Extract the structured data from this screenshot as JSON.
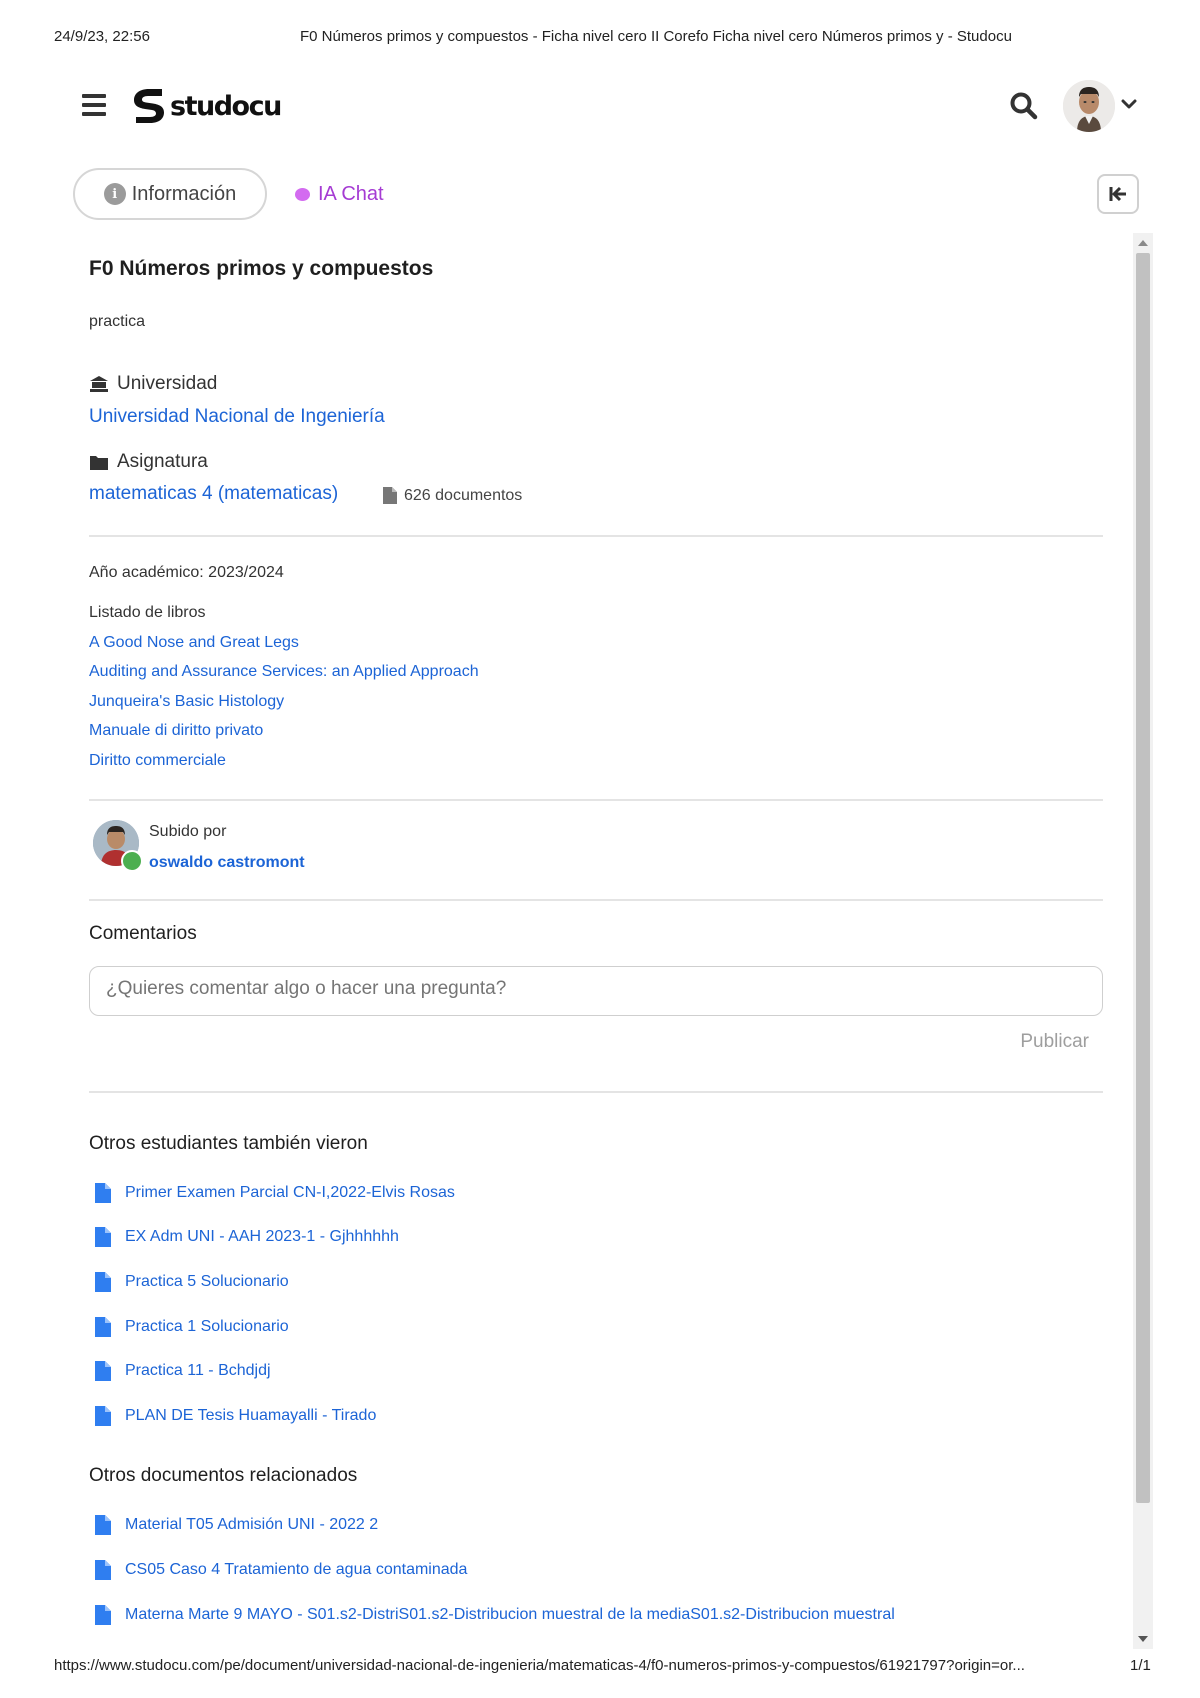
{
  "print_header": {
    "date": "24/9/23, 22:56",
    "title": "F0 Números primos y compuestos - Ficha nivel cero II Corefo Ficha nivel cero Números primos y - Studocu"
  },
  "print_footer": {
    "url": "https://www.studocu.com/pe/document/universidad-nacional-de-ingenieria/matematicas-4/f0-numeros-primos-y-compuestos/61921797?origin=or...",
    "page": "1/1"
  },
  "header": {
    "logo_text": "studocu"
  },
  "tabs": {
    "info_label": "Información",
    "chat_label": "IA Chat"
  },
  "document": {
    "title": "F0 Números primos y compuestos",
    "description": "practica",
    "university_label": "Universidad",
    "university_name": "Universidad Nacional de Ingeniería",
    "subject_label": "Asignatura",
    "subject_name": "matematicas 4 (matematicas)",
    "documents_count": "626 documentos",
    "academic_year": "Año académico: 2023/2024",
    "books_label": "Listado de libros",
    "books": [
      "A Good Nose and Great Legs",
      "Auditing and Assurance Services: an Applied Approach",
      "Junqueira's Basic Histology",
      "Manuale di diritto privato",
      "Diritto commerciale"
    ],
    "uploaded_by_label": "Subido por",
    "uploader_name": "oswaldo castromont"
  },
  "comments": {
    "heading": "Comentarios",
    "placeholder": "¿Quieres comentar algo o hacer una pregunta?",
    "publish_label": "Publicar"
  },
  "others_viewed": {
    "heading": "Otros estudiantes también vieron",
    "items": [
      "Primer Examen Parcial CN-I,2022-Elvis Rosas",
      "EX Adm UNI - AAH 2023-1 - Gjhhhhhh",
      "Practica 5 Solucionario",
      "Practica 1 Solucionario",
      "Practica 11 - Bchdjdj",
      "PLAN DE Tesis Huamayalli - Tirado"
    ]
  },
  "related": {
    "heading": "Otros documentos relacionados",
    "items": [
      "Material T05 Admisión UNI - 2022 2",
      "CS05 Caso 4 Tratamiento de agua contaminada",
      "Materna Marte 9 MAYO - S01.s2-DistriS01.s2-Distribucion muestral de la mediaS01.s2-Distribucion muestral"
    ]
  },
  "icons": {
    "menu": "hamburger-menu-icon",
    "search": "search-icon",
    "info": "info-icon",
    "chat": "ai-chat-icon",
    "collapse": "collapse-panel-icon",
    "university": "university-icon",
    "folder": "folder-icon",
    "file": "file-icon"
  },
  "colors": {
    "link": "#1c64d6",
    "chat_accent": "#a53bd3",
    "muted": "#9e9e9e"
  }
}
